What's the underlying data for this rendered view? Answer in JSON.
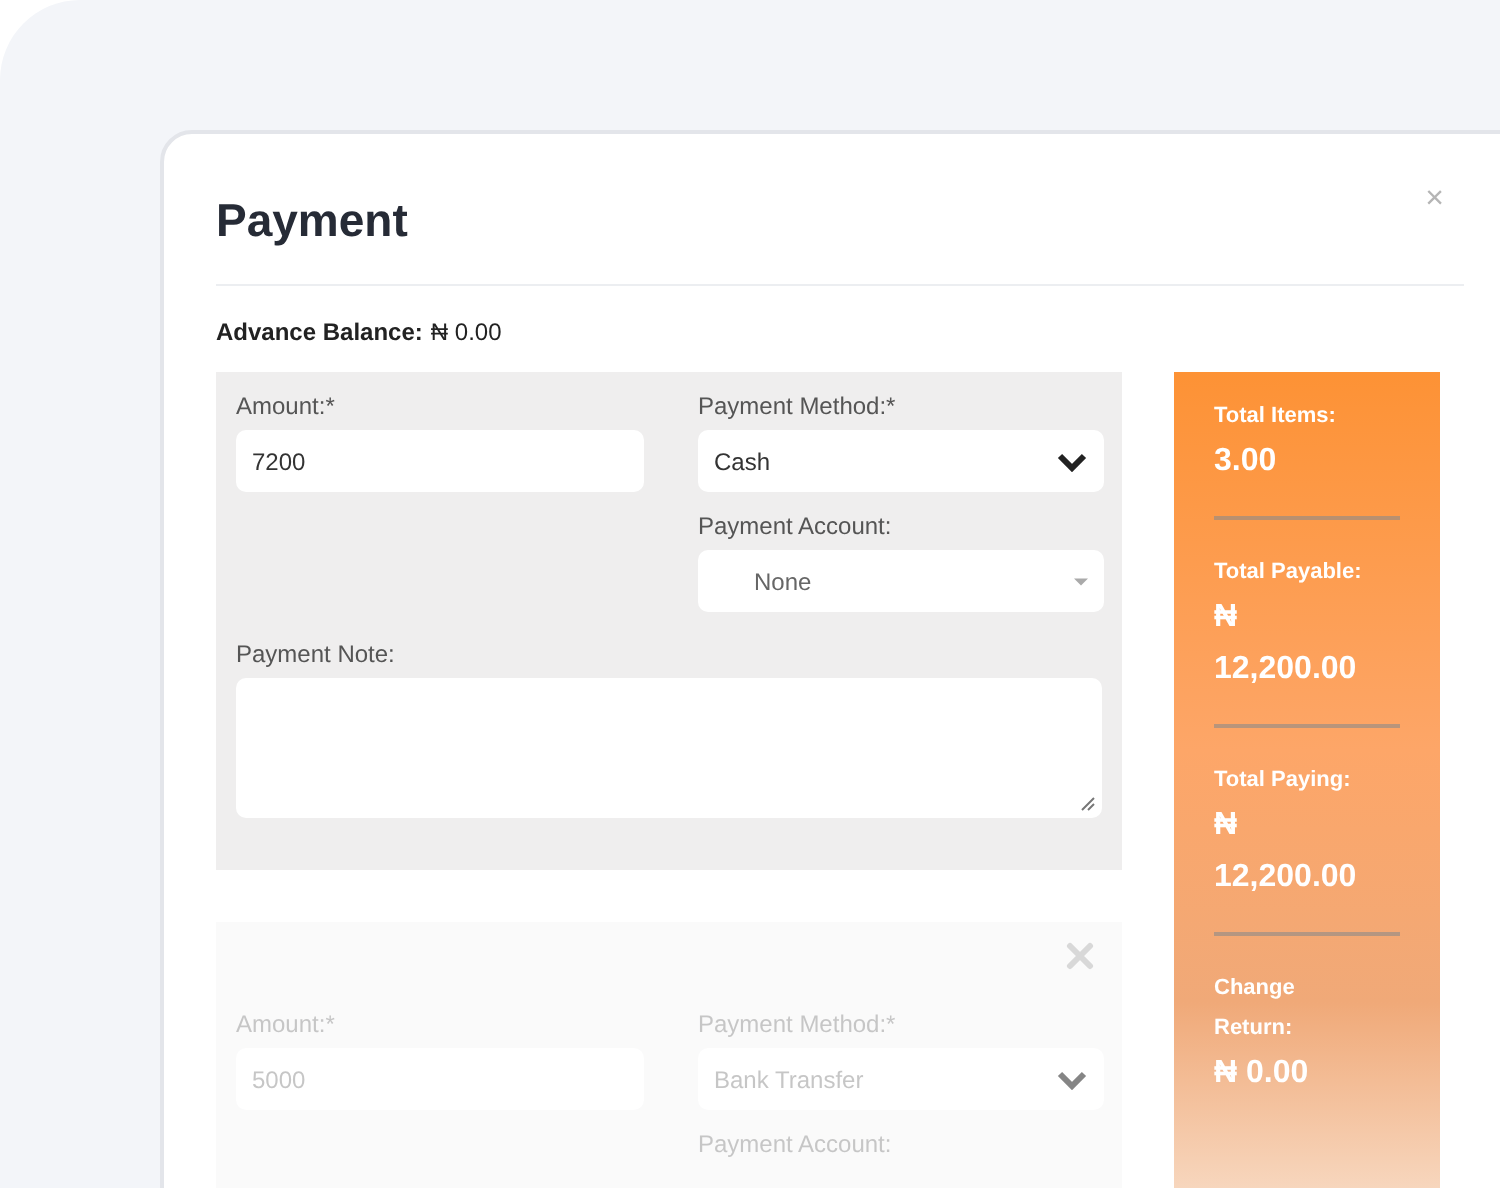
{
  "modal": {
    "title": "Payment",
    "close": "×"
  },
  "advance_balance": {
    "label": "Advance Balance:",
    "value": "₦ 0.00"
  },
  "payments": [
    {
      "amount_label": "Amount:*",
      "amount": "7200",
      "method_label": "Payment Method:*",
      "method": "Cash",
      "account_label": "Payment Account:",
      "account": "None",
      "note_label": "Payment Note:",
      "removable": false,
      "faded": false
    },
    {
      "amount_label": "Amount:*",
      "amount": "5000",
      "method_label": "Payment Method:*",
      "method": "Bank Transfer",
      "account_label": "Payment Account:",
      "removable": true,
      "faded": true
    }
  ],
  "summary": [
    {
      "label": "Total Items:",
      "value": "3.00"
    },
    {
      "label": "Total Payable:",
      "value": "₦ 12,200.00"
    },
    {
      "label": "Total Paying:",
      "value": "₦ 12,200.00"
    },
    {
      "label": "Change Return:",
      "value": "₦ 0.00"
    }
  ]
}
